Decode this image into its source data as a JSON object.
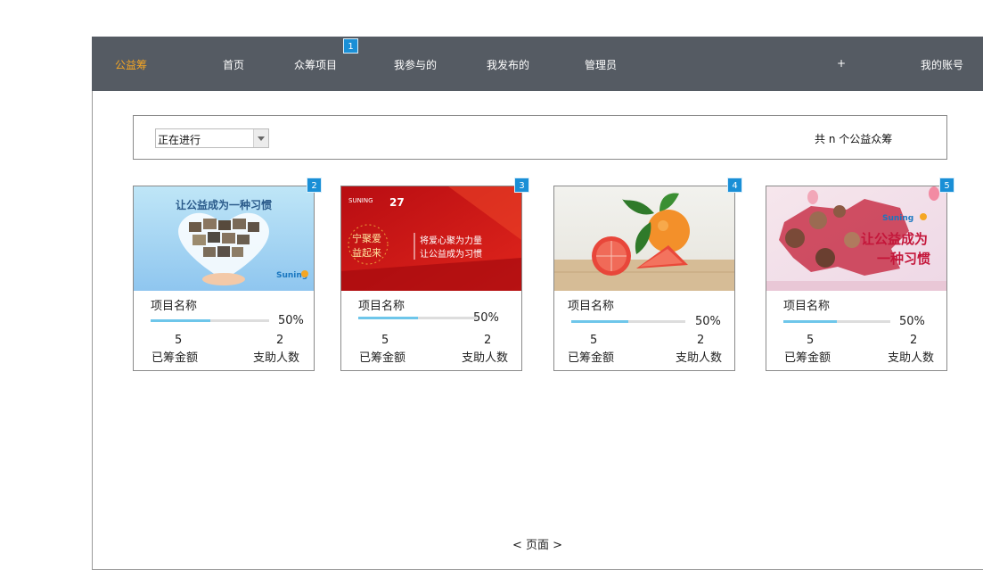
{
  "nav": {
    "brand": "公益筹",
    "items": [
      "首页",
      "众筹项目",
      "我参与的",
      "我发布的",
      "管理员"
    ],
    "plus": "+",
    "account": "我的账号",
    "badge": "1"
  },
  "filter": {
    "selected": "正在进行",
    "total_text": "共 n 个公益众筹"
  },
  "cards": [
    {
      "badge": "2",
      "name": "项目名称",
      "progress": 0.5,
      "percent": "50%",
      "raised_value": "5",
      "raised_label": "已筹金额",
      "supporters_value": "2",
      "supporters_label": "支助人数",
      "image_text": "让公益成为一种习惯",
      "image_logo": "Suning"
    },
    {
      "badge": "3",
      "name": "项目名称",
      "progress": 0.5,
      "percent": "50%",
      "raised_value": "5",
      "raised_label": "已筹金额",
      "supporters_value": "2",
      "supporters_label": "支助人数",
      "image_text_left": "宁聚爱 益起来",
      "image_text_right": "将爱心聚为力量 让公益成为习惯",
      "image_logo": "SUNING",
      "image_number": "27"
    },
    {
      "badge": "4",
      "name": "项目名称",
      "progress": 0.5,
      "percent": "50%",
      "raised_value": "5",
      "raised_label": "已筹金额",
      "supporters_value": "2",
      "supporters_label": "支助人数"
    },
    {
      "badge": "5",
      "name": "项目名称",
      "progress": 0.5,
      "percent": "50%",
      "raised_value": "5",
      "raised_label": "已筹金额",
      "supporters_value": "2",
      "supporters_label": "支助人数",
      "image_text": "让公益成为 一种习惯",
      "image_logo": "Suning"
    }
  ],
  "pager": "< 页面 >",
  "colors": {
    "nav_bg": "#555b63",
    "brand": "#f5a623",
    "badge": "#1a8fd6",
    "progress": "#6ec6ea"
  }
}
